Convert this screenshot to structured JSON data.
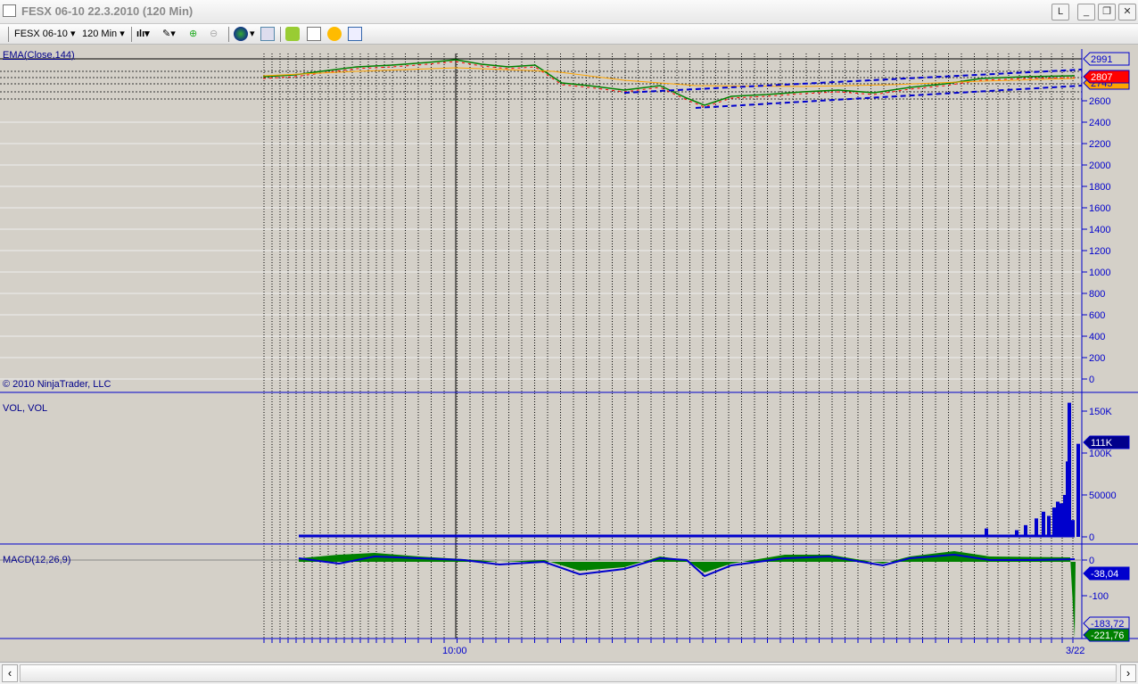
{
  "window": {
    "title": "FESX 06-10  22.3.2010 (120 Min)",
    "buttons": [
      "L",
      "_",
      "❐",
      "✕"
    ]
  },
  "toolbar": {
    "instrument": "FESX 06-10",
    "interval": "120 Min"
  },
  "panels": {
    "price": {
      "label": "EMA(Close,144)",
      "copyright": "© 2010 NinjaTrader, LLC",
      "axis": [
        "2991",
        "2600",
        "2400",
        "2200",
        "2000",
        "1800",
        "1600",
        "1400",
        "1200",
        "1000",
        "800",
        "600",
        "400",
        "200",
        "0"
      ],
      "markers": {
        "top": "2991",
        "last": "2807",
        "ema": "2745"
      }
    },
    "volume": {
      "label": "VOL, VOL",
      "axis": [
        "150K",
        "100K",
        "50000",
        "0"
      ],
      "marker": "111K"
    },
    "macd": {
      "label": "MACD(12,26,9)",
      "axis": [
        "0",
        "-100"
      ],
      "markers": {
        "macd": "-38,04",
        "avg": "-183,72",
        "diff": "-221,76"
      }
    }
  },
  "xaxis": {
    "labels": [
      "10:00",
      "3/22"
    ]
  },
  "colors": {
    "axis": "#0000cd",
    "bg": "#d4d0c8",
    "up": "#008000",
    "down": "#ff0000",
    "ema": "#ffa500",
    "macd_hist": "#008000",
    "volume": "#0000cd"
  }
}
